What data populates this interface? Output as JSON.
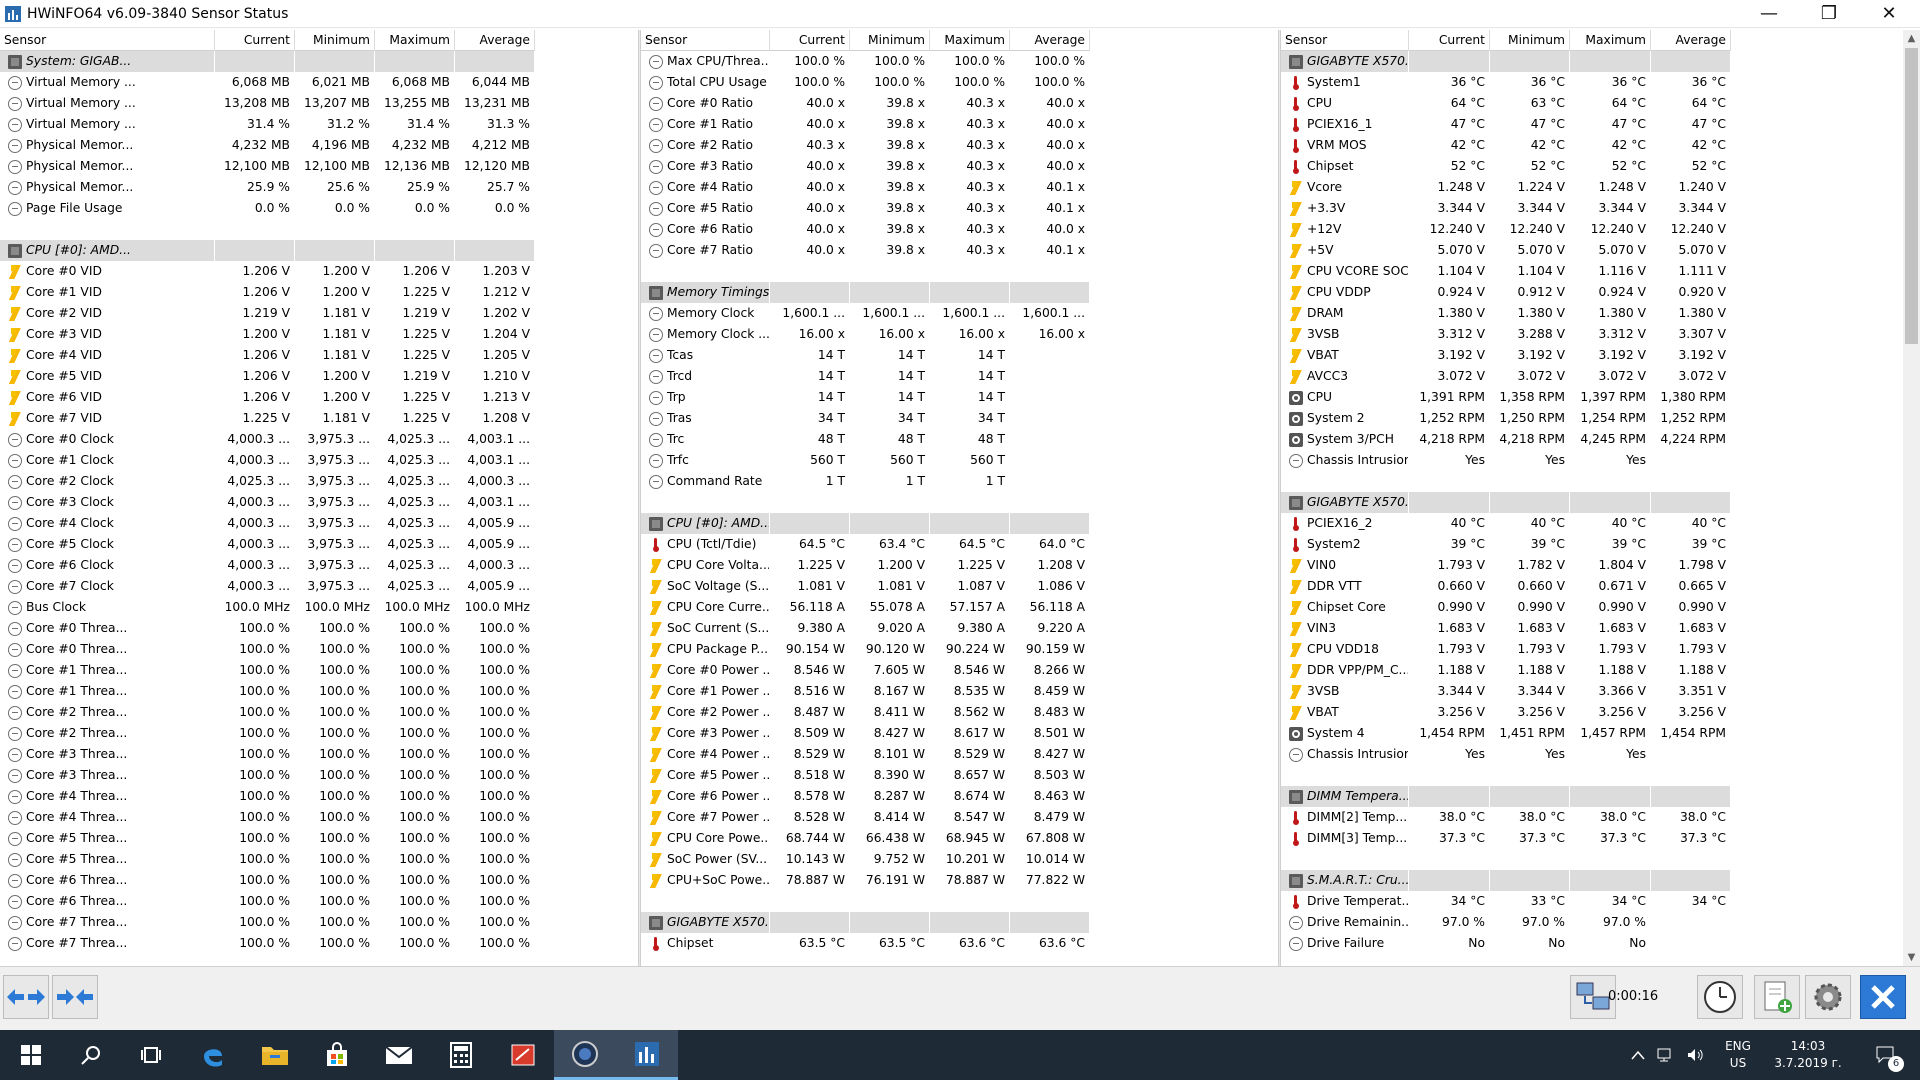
{
  "window": {
    "title": "HWiNFO64 v6.09-3840 Sensor Status",
    "minimize": "—",
    "maximize": "❐",
    "close": "✕"
  },
  "columns": [
    "Sensor",
    "Current",
    "Minimum",
    "Maximum",
    "Average"
  ],
  "pane1": [
    {
      "t": "g",
      "n": "System: GIGAB..."
    },
    {
      "t": "clock",
      "n": "Virtual Memory ...",
      "v": [
        "6,068 MB",
        "6,021 MB",
        "6,068 MB",
        "6,044 MB"
      ]
    },
    {
      "t": "clock",
      "n": "Virtual Memory ...",
      "v": [
        "13,208 MB",
        "13,207 MB",
        "13,255 MB",
        "13,231 MB"
      ]
    },
    {
      "t": "clock",
      "n": "Virtual Memory ...",
      "v": [
        "31.4 %",
        "31.2 %",
        "31.4 %",
        "31.3 %"
      ]
    },
    {
      "t": "clock",
      "n": "Physical Memor...",
      "v": [
        "4,232 MB",
        "4,196 MB",
        "4,232 MB",
        "4,212 MB"
      ]
    },
    {
      "t": "clock",
      "n": "Physical Memor...",
      "v": [
        "12,100 MB",
        "12,100 MB",
        "12,136 MB",
        "12,120 MB"
      ]
    },
    {
      "t": "clock",
      "n": "Physical Memor...",
      "v": [
        "25.9 %",
        "25.6 %",
        "25.9 %",
        "25.7 %"
      ]
    },
    {
      "t": "clock",
      "n": "Page File Usage",
      "v": [
        "0.0 %",
        "0.0 %",
        "0.0 %",
        "0.0 %"
      ]
    },
    {
      "t": "blank"
    },
    {
      "t": "g",
      "n": "CPU [#0]: AMD..."
    },
    {
      "t": "volt",
      "n": "Core #0 VID",
      "v": [
        "1.206 V",
        "1.200 V",
        "1.206 V",
        "1.203 V"
      ]
    },
    {
      "t": "volt",
      "n": "Core #1 VID",
      "v": [
        "1.206 V",
        "1.200 V",
        "1.225 V",
        "1.212 V"
      ]
    },
    {
      "t": "volt",
      "n": "Core #2 VID",
      "v": [
        "1.219 V",
        "1.181 V",
        "1.219 V",
        "1.202 V"
      ]
    },
    {
      "t": "volt",
      "n": "Core #3 VID",
      "v": [
        "1.200 V",
        "1.181 V",
        "1.225 V",
        "1.204 V"
      ]
    },
    {
      "t": "volt",
      "n": "Core #4 VID",
      "v": [
        "1.206 V",
        "1.181 V",
        "1.225 V",
        "1.205 V"
      ]
    },
    {
      "t": "volt",
      "n": "Core #5 VID",
      "v": [
        "1.206 V",
        "1.200 V",
        "1.219 V",
        "1.210 V"
      ]
    },
    {
      "t": "volt",
      "n": "Core #6 VID",
      "v": [
        "1.206 V",
        "1.200 V",
        "1.225 V",
        "1.213 V"
      ]
    },
    {
      "t": "volt",
      "n": "Core #7 VID",
      "v": [
        "1.225 V",
        "1.181 V",
        "1.225 V",
        "1.208 V"
      ]
    },
    {
      "t": "clock",
      "n": "Core #0 Clock",
      "v": [
        "4,000.3 ...",
        "3,975.3 ...",
        "4,025.3 ...",
        "4,003.1 ..."
      ]
    },
    {
      "t": "clock",
      "n": "Core #1 Clock",
      "v": [
        "4,000.3 ...",
        "3,975.3 ...",
        "4,025.3 ...",
        "4,003.1 ..."
      ]
    },
    {
      "t": "clock",
      "n": "Core #2 Clock",
      "v": [
        "4,025.3 ...",
        "3,975.3 ...",
        "4,025.3 ...",
        "4,000.3 ..."
      ]
    },
    {
      "t": "clock",
      "n": "Core #3 Clock",
      "v": [
        "4,000.3 ...",
        "3,975.3 ...",
        "4,025.3 ...",
        "4,003.1 ..."
      ]
    },
    {
      "t": "clock",
      "n": "Core #4 Clock",
      "v": [
        "4,000.3 ...",
        "3,975.3 ...",
        "4,025.3 ...",
        "4,005.9 ..."
      ]
    },
    {
      "t": "clock",
      "n": "Core #5 Clock",
      "v": [
        "4,000.3 ...",
        "3,975.3 ...",
        "4,025.3 ...",
        "4,005.9 ..."
      ]
    },
    {
      "t": "clock",
      "n": "Core #6 Clock",
      "v": [
        "4,000.3 ...",
        "3,975.3 ...",
        "4,025.3 ...",
        "4,000.3 ..."
      ]
    },
    {
      "t": "clock",
      "n": "Core #7 Clock",
      "v": [
        "4,000.3 ...",
        "3,975.3 ...",
        "4,025.3 ...",
        "4,005.9 ..."
      ]
    },
    {
      "t": "clock",
      "n": "Bus Clock",
      "v": [
        "100.0 MHz",
        "100.0 MHz",
        "100.0 MHz",
        "100.0 MHz"
      ]
    },
    {
      "t": "clock",
      "n": "Core #0 Threa...",
      "v": [
        "100.0 %",
        "100.0 %",
        "100.0 %",
        "100.0 %"
      ]
    },
    {
      "t": "clock",
      "n": "Core #0 Threa...",
      "v": [
        "100.0 %",
        "100.0 %",
        "100.0 %",
        "100.0 %"
      ]
    },
    {
      "t": "clock",
      "n": "Core #1 Threa...",
      "v": [
        "100.0 %",
        "100.0 %",
        "100.0 %",
        "100.0 %"
      ]
    },
    {
      "t": "clock",
      "n": "Core #1 Threa...",
      "v": [
        "100.0 %",
        "100.0 %",
        "100.0 %",
        "100.0 %"
      ]
    },
    {
      "t": "clock",
      "n": "Core #2 Threa...",
      "v": [
        "100.0 %",
        "100.0 %",
        "100.0 %",
        "100.0 %"
      ]
    },
    {
      "t": "clock",
      "n": "Core #2 Threa...",
      "v": [
        "100.0 %",
        "100.0 %",
        "100.0 %",
        "100.0 %"
      ]
    },
    {
      "t": "clock",
      "n": "Core #3 Threa...",
      "v": [
        "100.0 %",
        "100.0 %",
        "100.0 %",
        "100.0 %"
      ]
    },
    {
      "t": "clock",
      "n": "Core #3 Threa...",
      "v": [
        "100.0 %",
        "100.0 %",
        "100.0 %",
        "100.0 %"
      ]
    },
    {
      "t": "clock",
      "n": "Core #4 Threa...",
      "v": [
        "100.0 %",
        "100.0 %",
        "100.0 %",
        "100.0 %"
      ]
    },
    {
      "t": "clock",
      "n": "Core #4 Threa...",
      "v": [
        "100.0 %",
        "100.0 %",
        "100.0 %",
        "100.0 %"
      ]
    },
    {
      "t": "clock",
      "n": "Core #5 Threa...",
      "v": [
        "100.0 %",
        "100.0 %",
        "100.0 %",
        "100.0 %"
      ]
    },
    {
      "t": "clock",
      "n": "Core #5 Threa...",
      "v": [
        "100.0 %",
        "100.0 %",
        "100.0 %",
        "100.0 %"
      ]
    },
    {
      "t": "clock",
      "n": "Core #6 Threa...",
      "v": [
        "100.0 %",
        "100.0 %",
        "100.0 %",
        "100.0 %"
      ]
    },
    {
      "t": "clock",
      "n": "Core #6 Threa...",
      "v": [
        "100.0 %",
        "100.0 %",
        "100.0 %",
        "100.0 %"
      ]
    },
    {
      "t": "clock",
      "n": "Core #7 Threa...",
      "v": [
        "100.0 %",
        "100.0 %",
        "100.0 %",
        "100.0 %"
      ]
    },
    {
      "t": "clock",
      "n": "Core #7 Threa...",
      "v": [
        "100.0 %",
        "100.0 %",
        "100.0 %",
        "100.0 %"
      ]
    }
  ],
  "pane2": [
    {
      "t": "clock",
      "n": "Max CPU/Threa...",
      "v": [
        "100.0 %",
        "100.0 %",
        "100.0 %",
        "100.0 %"
      ]
    },
    {
      "t": "clock",
      "n": "Total CPU Usage",
      "v": [
        "100.0 %",
        "100.0 %",
        "100.0 %",
        "100.0 %"
      ]
    },
    {
      "t": "clock",
      "n": "Core #0 Ratio",
      "v": [
        "40.0 x",
        "39.8 x",
        "40.3 x",
        "40.0 x"
      ]
    },
    {
      "t": "clock",
      "n": "Core #1 Ratio",
      "v": [
        "40.0 x",
        "39.8 x",
        "40.3 x",
        "40.0 x"
      ]
    },
    {
      "t": "clock",
      "n": "Core #2 Ratio",
      "v": [
        "40.3 x",
        "39.8 x",
        "40.3 x",
        "40.0 x"
      ]
    },
    {
      "t": "clock",
      "n": "Core #3 Ratio",
      "v": [
        "40.0 x",
        "39.8 x",
        "40.3 x",
        "40.0 x"
      ]
    },
    {
      "t": "clock",
      "n": "Core #4 Ratio",
      "v": [
        "40.0 x",
        "39.8 x",
        "40.3 x",
        "40.1 x"
      ]
    },
    {
      "t": "clock",
      "n": "Core #5 Ratio",
      "v": [
        "40.0 x",
        "39.8 x",
        "40.3 x",
        "40.1 x"
      ]
    },
    {
      "t": "clock",
      "n": "Core #6 Ratio",
      "v": [
        "40.0 x",
        "39.8 x",
        "40.3 x",
        "40.0 x"
      ]
    },
    {
      "t": "clock",
      "n": "Core #7 Ratio",
      "v": [
        "40.0 x",
        "39.8 x",
        "40.3 x",
        "40.1 x"
      ]
    },
    {
      "t": "blank"
    },
    {
      "t": "g",
      "n": "Memory Timings"
    },
    {
      "t": "clock",
      "n": "Memory Clock",
      "v": [
        "1,600.1 ...",
        "1,600.1 ...",
        "1,600.1 ...",
        "1,600.1 ..."
      ]
    },
    {
      "t": "clock",
      "n": "Memory Clock ...",
      "v": [
        "16.00 x",
        "16.00 x",
        "16.00 x",
        "16.00 x"
      ]
    },
    {
      "t": "clock",
      "n": "Tcas",
      "v": [
        "14 T",
        "14 T",
        "14 T",
        ""
      ]
    },
    {
      "t": "clock",
      "n": "Trcd",
      "v": [
        "14 T",
        "14 T",
        "14 T",
        ""
      ]
    },
    {
      "t": "clock",
      "n": "Trp",
      "v": [
        "14 T",
        "14 T",
        "14 T",
        ""
      ]
    },
    {
      "t": "clock",
      "n": "Tras",
      "v": [
        "34 T",
        "34 T",
        "34 T",
        ""
      ]
    },
    {
      "t": "clock",
      "n": "Trc",
      "v": [
        "48 T",
        "48 T",
        "48 T",
        ""
      ]
    },
    {
      "t": "clock",
      "n": "Trfc",
      "v": [
        "560 T",
        "560 T",
        "560 T",
        ""
      ]
    },
    {
      "t": "clock",
      "n": "Command Rate",
      "v": [
        "1 T",
        "1 T",
        "1 T",
        ""
      ]
    },
    {
      "t": "blank"
    },
    {
      "t": "g",
      "n": "CPU [#0]: AMD..."
    },
    {
      "t": "temp",
      "n": "CPU (Tctl/Tdie)",
      "v": [
        "64.5 °C",
        "63.4 °C",
        "64.5 °C",
        "64.0 °C"
      ]
    },
    {
      "t": "volt",
      "n": "CPU Core Volta...",
      "v": [
        "1.225 V",
        "1.200 V",
        "1.225 V",
        "1.208 V"
      ]
    },
    {
      "t": "volt",
      "n": "SoC Voltage (S...",
      "v": [
        "1.081 V",
        "1.081 V",
        "1.087 V",
        "1.086 V"
      ]
    },
    {
      "t": "volt",
      "n": "CPU Core Curre...",
      "v": [
        "56.118 A",
        "55.078 A",
        "57.157 A",
        "56.118 A"
      ]
    },
    {
      "t": "volt",
      "n": "SoC Current (S...",
      "v": [
        "9.380 A",
        "9.020 A",
        "9.380 A",
        "9.220 A"
      ]
    },
    {
      "t": "volt",
      "n": "CPU Package P...",
      "v": [
        "90.154 W",
        "90.120 W",
        "90.224 W",
        "90.159 W"
      ]
    },
    {
      "t": "volt",
      "n": "Core #0 Power ...",
      "v": [
        "8.546 W",
        "7.605 W",
        "8.546 W",
        "8.266 W"
      ]
    },
    {
      "t": "volt",
      "n": "Core #1 Power ...",
      "v": [
        "8.516 W",
        "8.167 W",
        "8.535 W",
        "8.459 W"
      ]
    },
    {
      "t": "volt",
      "n": "Core #2 Power ...",
      "v": [
        "8.487 W",
        "8.411 W",
        "8.562 W",
        "8.483 W"
      ]
    },
    {
      "t": "volt",
      "n": "Core #3 Power ...",
      "v": [
        "8.509 W",
        "8.427 W",
        "8.617 W",
        "8.501 W"
      ]
    },
    {
      "t": "volt",
      "n": "Core #4 Power ...",
      "v": [
        "8.529 W",
        "8.101 W",
        "8.529 W",
        "8.427 W"
      ]
    },
    {
      "t": "volt",
      "n": "Core #5 Power ...",
      "v": [
        "8.518 W",
        "8.390 W",
        "8.657 W",
        "8.503 W"
      ]
    },
    {
      "t": "volt",
      "n": "Core #6 Power ...",
      "v": [
        "8.578 W",
        "8.287 W",
        "8.674 W",
        "8.463 W"
      ]
    },
    {
      "t": "volt",
      "n": "Core #7 Power ...",
      "v": [
        "8.528 W",
        "8.414 W",
        "8.547 W",
        "8.479 W"
      ]
    },
    {
      "t": "volt",
      "n": "CPU Core Powe...",
      "v": [
        "68.744 W",
        "66.438 W",
        "68.945 W",
        "67.808 W"
      ]
    },
    {
      "t": "volt",
      "n": "SoC Power (SV...",
      "v": [
        "10.143 W",
        "9.752 W",
        "10.201 W",
        "10.014 W"
      ]
    },
    {
      "t": "volt",
      "n": "CPU+SoC Powe...",
      "v": [
        "78.887 W",
        "76.191 W",
        "78.887 W",
        "77.822 W"
      ]
    },
    {
      "t": "blank"
    },
    {
      "t": "g",
      "n": "GIGABYTE X570..."
    },
    {
      "t": "temp",
      "n": "Chipset",
      "v": [
        "63.5 °C",
        "63.5 °C",
        "63.6 °C",
        "63.6 °C"
      ]
    }
  ],
  "pane3": [
    {
      "t": "g",
      "n": "GIGABYTE X570..."
    },
    {
      "t": "temp",
      "n": "System1",
      "v": [
        "36 °C",
        "36 °C",
        "36 °C",
        "36 °C"
      ]
    },
    {
      "t": "temp",
      "n": "CPU",
      "v": [
        "64 °C",
        "63 °C",
        "64 °C",
        "64 °C"
      ]
    },
    {
      "t": "temp",
      "n": "PCIEX16_1",
      "v": [
        "47 °C",
        "47 °C",
        "47 °C",
        "47 °C"
      ]
    },
    {
      "t": "temp",
      "n": "VRM MOS",
      "v": [
        "42 °C",
        "42 °C",
        "42 °C",
        "42 °C"
      ]
    },
    {
      "t": "temp",
      "n": "Chipset",
      "v": [
        "52 °C",
        "52 °C",
        "52 °C",
        "52 °C"
      ]
    },
    {
      "t": "volt",
      "n": "Vcore",
      "v": [
        "1.248 V",
        "1.224 V",
        "1.248 V",
        "1.240 V"
      ]
    },
    {
      "t": "volt",
      "n": "+3.3V",
      "v": [
        "3.344 V",
        "3.344 V",
        "3.344 V",
        "3.344 V"
      ]
    },
    {
      "t": "volt",
      "n": "+12V",
      "v": [
        "12.240 V",
        "12.240 V",
        "12.240 V",
        "12.240 V"
      ]
    },
    {
      "t": "volt",
      "n": "+5V",
      "v": [
        "5.070 V",
        "5.070 V",
        "5.070 V",
        "5.070 V"
      ]
    },
    {
      "t": "volt",
      "n": "CPU VCORE SOC",
      "v": [
        "1.104 V",
        "1.104 V",
        "1.116 V",
        "1.111 V"
      ]
    },
    {
      "t": "volt",
      "n": "CPU VDDP",
      "v": [
        "0.924 V",
        "0.912 V",
        "0.924 V",
        "0.920 V"
      ]
    },
    {
      "t": "volt",
      "n": "DRAM",
      "v": [
        "1.380 V",
        "1.380 V",
        "1.380 V",
        "1.380 V"
      ]
    },
    {
      "t": "volt",
      "n": "3VSB",
      "v": [
        "3.312 V",
        "3.288 V",
        "3.312 V",
        "3.307 V"
      ]
    },
    {
      "t": "volt",
      "n": "VBAT",
      "v": [
        "3.192 V",
        "3.192 V",
        "3.192 V",
        "3.192 V"
      ]
    },
    {
      "t": "volt",
      "n": "AVCC3",
      "v": [
        "3.072 V",
        "3.072 V",
        "3.072 V",
        "3.072 V"
      ]
    },
    {
      "t": "fan",
      "n": "CPU",
      "v": [
        "1,391 RPM",
        "1,358 RPM",
        "1,397 RPM",
        "1,380 RPM"
      ]
    },
    {
      "t": "fan",
      "n": "System 2",
      "v": [
        "1,252 RPM",
        "1,250 RPM",
        "1,254 RPM",
        "1,252 RPM"
      ]
    },
    {
      "t": "fan",
      "n": "System 3/PCH",
      "v": [
        "4,218 RPM",
        "4,218 RPM",
        "4,245 RPM",
        "4,224 RPM"
      ]
    },
    {
      "t": "clock",
      "n": "Chassis Intrusion",
      "v": [
        "Yes",
        "Yes",
        "Yes",
        ""
      ]
    },
    {
      "t": "blank"
    },
    {
      "t": "g",
      "n": "GIGABYTE X570..."
    },
    {
      "t": "temp",
      "n": "PCIEX16_2",
      "v": [
        "40 °C",
        "40 °C",
        "40 °C",
        "40 °C"
      ]
    },
    {
      "t": "temp",
      "n": "System2",
      "v": [
        "39 °C",
        "39 °C",
        "39 °C",
        "39 °C"
      ]
    },
    {
      "t": "volt",
      "n": "VIN0",
      "v": [
        "1.793 V",
        "1.782 V",
        "1.804 V",
        "1.798 V"
      ]
    },
    {
      "t": "volt",
      "n": "DDR VTT",
      "v": [
        "0.660 V",
        "0.660 V",
        "0.671 V",
        "0.665 V"
      ]
    },
    {
      "t": "volt",
      "n": "Chipset Core",
      "v": [
        "0.990 V",
        "0.990 V",
        "0.990 V",
        "0.990 V"
      ]
    },
    {
      "t": "volt",
      "n": "VIN3",
      "v": [
        "1.683 V",
        "1.683 V",
        "1.683 V",
        "1.683 V"
      ]
    },
    {
      "t": "volt",
      "n": "CPU VDD18",
      "v": [
        "1.793 V",
        "1.793 V",
        "1.793 V",
        "1.793 V"
      ]
    },
    {
      "t": "volt",
      "n": "DDR VPP/PM_C...",
      "v": [
        "1.188 V",
        "1.188 V",
        "1.188 V",
        "1.188 V"
      ]
    },
    {
      "t": "volt",
      "n": "3VSB",
      "v": [
        "3.344 V",
        "3.344 V",
        "3.366 V",
        "3.351 V"
      ]
    },
    {
      "t": "volt",
      "n": "VBAT",
      "v": [
        "3.256 V",
        "3.256 V",
        "3.256 V",
        "3.256 V"
      ]
    },
    {
      "t": "fan",
      "n": "System 4",
      "v": [
        "1,454 RPM",
        "1,451 RPM",
        "1,457 RPM",
        "1,454 RPM"
      ]
    },
    {
      "t": "clock",
      "n": "Chassis Intrusion",
      "v": [
        "Yes",
        "Yes",
        "Yes",
        ""
      ]
    },
    {
      "t": "blank"
    },
    {
      "t": "g",
      "n": "DIMM Tempera..."
    },
    {
      "t": "temp",
      "n": "DIMM[2] Temp...",
      "v": [
        "38.0 °C",
        "38.0 °C",
        "38.0 °C",
        "38.0 °C"
      ]
    },
    {
      "t": "temp",
      "n": "DIMM[3] Temp...",
      "v": [
        "37.3 °C",
        "37.3 °C",
        "37.3 °C",
        "37.3 °C"
      ]
    },
    {
      "t": "blank"
    },
    {
      "t": "g",
      "n": "S.M.A.R.T.: Cru..."
    },
    {
      "t": "temp",
      "n": "Drive Temperat...",
      "v": [
        "34 °C",
        "33 °C",
        "34 °C",
        "34 °C"
      ]
    },
    {
      "t": "clock",
      "n": "Drive Remainin...",
      "v": [
        "97.0 %",
        "97.0 %",
        "97.0 %",
        ""
      ]
    },
    {
      "t": "clock",
      "n": "Drive Failure",
      "v": [
        "No",
        "No",
        "No",
        ""
      ]
    }
  ],
  "bottom": {
    "elapsed": "0:00:16"
  },
  "taskbar": {
    "lang": "ENG",
    "region": "US",
    "time": "14:03",
    "date": "3.7.2019 г.",
    "notifications": "6"
  }
}
